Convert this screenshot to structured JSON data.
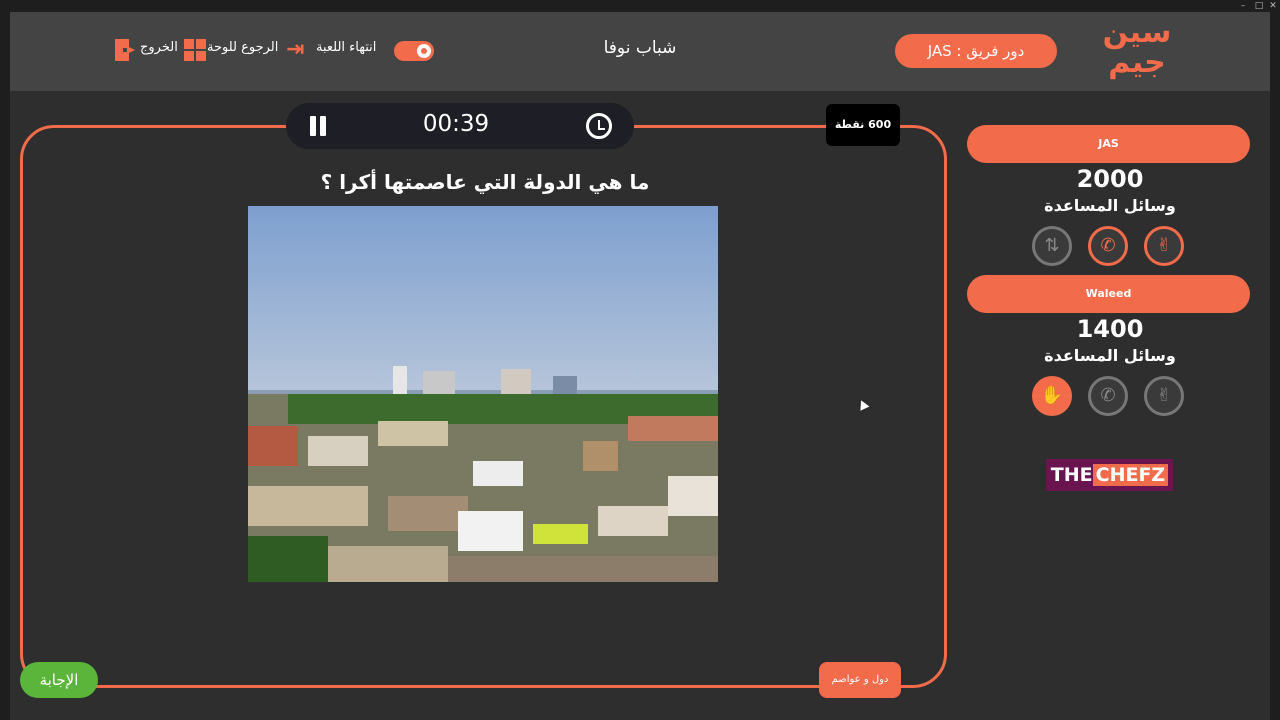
{
  "header": {
    "logo_text": "سين جيم",
    "turn_label": "دور فريق : JAS",
    "game_title": "شباب نوفا",
    "end_game_label": "انتهاء اللعبة",
    "back_to_board_label": "الرجوع للوحة",
    "exit_label": "الخروج"
  },
  "question_panel": {
    "timer": "00:39",
    "points": "600 نقطة",
    "question_text": "ما هي الدولة التي عاصمتها أكرا ؟",
    "category": "دول و عواصم",
    "answer_button": "الإجابة"
  },
  "teams": [
    {
      "name": "JAS",
      "score": "2000",
      "helpers_label": "وسائل المساعدة",
      "aids": [
        {
          "icon": "swap-icon",
          "state": "used"
        },
        {
          "icon": "phone-icon",
          "state": "available"
        },
        {
          "icon": "two-answers-icon",
          "state": "available"
        }
      ]
    },
    {
      "name": "Waleed",
      "score": "1400",
      "helpers_label": "وسائل المساعدة",
      "aids": [
        {
          "icon": "hand-icon",
          "state": "active"
        },
        {
          "icon": "phone-icon",
          "state": "used"
        },
        {
          "icon": "two-answers-icon",
          "state": "used"
        }
      ]
    }
  ],
  "sponsor": {
    "part1": "THE",
    "part2": "CHEFZ"
  },
  "colors": {
    "accent": "#f26b4a",
    "answer": "#5bb53b",
    "background": "#2e2e2e",
    "header": "#444444"
  }
}
